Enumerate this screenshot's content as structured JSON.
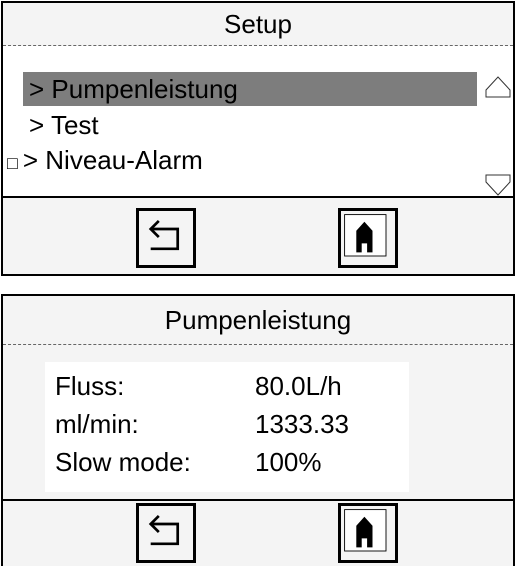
{
  "setup": {
    "title": "Setup",
    "items": [
      {
        "label": "> Pumpenleistung",
        "selected": true,
        "checkbox": false
      },
      {
        "label": "> Test",
        "selected": false,
        "checkbox": false
      },
      {
        "label": "> Niveau-Alarm",
        "selected": false,
        "checkbox": true,
        "checkbox_glyph": "□"
      }
    ],
    "scroll_up_icon": "triangle-up-icon",
    "scroll_down_icon": "triangle-down-icon",
    "back_icon": "back-arrow-icon",
    "home_icon": "home-icon"
  },
  "pump": {
    "title": "Pumpenleistung",
    "rows": [
      {
        "label": "Fluss:",
        "value": "80.0L/h"
      },
      {
        "label": "ml/min:",
        "value": "1333.33"
      },
      {
        "label": "Slow mode:",
        "value": "100%"
      }
    ],
    "back_icon": "back-arrow-icon",
    "home_icon": "home-icon"
  },
  "colors": {
    "selection": "#7d7d7d",
    "panel_bg": "#f4f4f4",
    "border": "#000000"
  }
}
